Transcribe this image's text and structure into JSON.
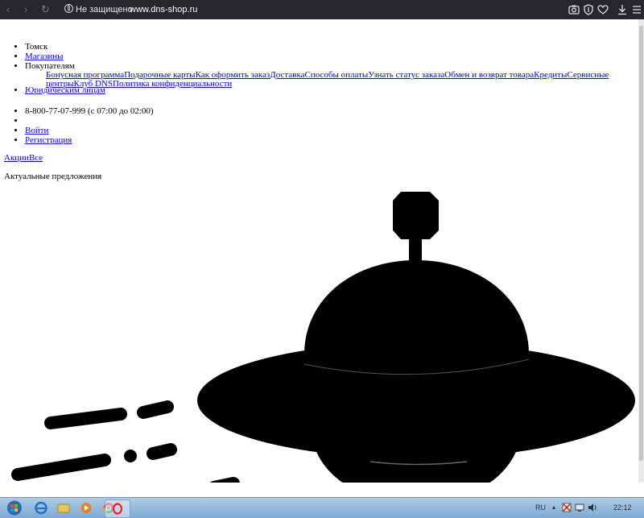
{
  "browser": {
    "security_label": "Не защищено",
    "url": "www.dns-shop.ru"
  },
  "header": {
    "city": "Томск",
    "shops": "Магазины",
    "customers": "Покупателям",
    "customer_links": [
      "Бонусная программа",
      "Подарочные карты",
      "Как оформить заказ",
      "Доставка",
      "Способы оплаты",
      "Узнать статус заказа",
      "Обмен и возврат товара",
      "Кредиты",
      "Сервисные центры",
      "Клуб DNS",
      "Политика конфиденциальности"
    ],
    "legal": "Юридическим лицам",
    "phone": "8-800-77-07-999 (с 07:00 до 02:00)",
    "login": "Войти",
    "register": "Регистрация"
  },
  "promo": {
    "actions": "Акции",
    "all": "Все",
    "current_offers": "Актуальные предложения"
  },
  "taskbar": {
    "language": "RU",
    "clock": "22:12"
  }
}
